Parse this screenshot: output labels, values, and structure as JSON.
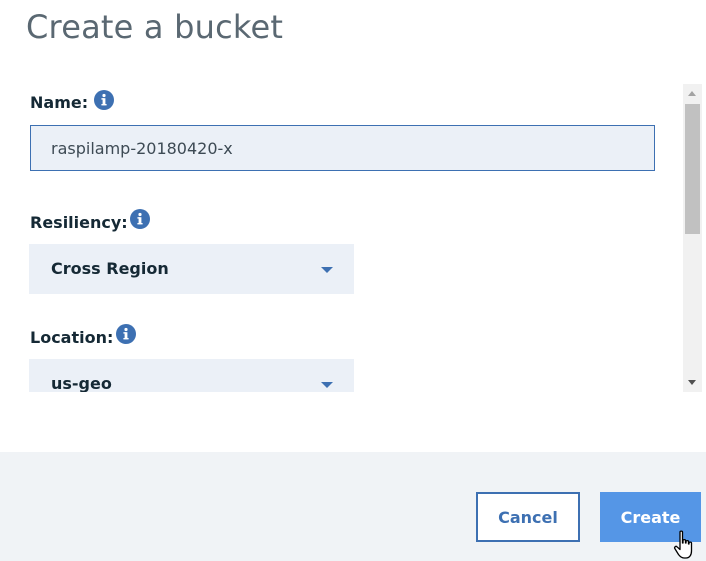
{
  "dialog": {
    "title": "Create a bucket"
  },
  "form": {
    "name": {
      "label": "Name:",
      "value": "raspilamp-20180420-x"
    },
    "resiliency": {
      "label": "Resiliency:",
      "selected": "Cross Region"
    },
    "location": {
      "label": "Location:",
      "selected": "us-geo"
    }
  },
  "footer": {
    "cancel_label": "Cancel",
    "create_label": "Create"
  },
  "colors": {
    "accent": "#3d70b2",
    "primary_button": "#5596e6",
    "field_background": "#ebf0f7",
    "footer_background": "#f0f3f6"
  },
  "icons": {
    "info": "info-icon",
    "caret": "chevron-down-icon",
    "cursor": "hand-pointer-icon"
  }
}
